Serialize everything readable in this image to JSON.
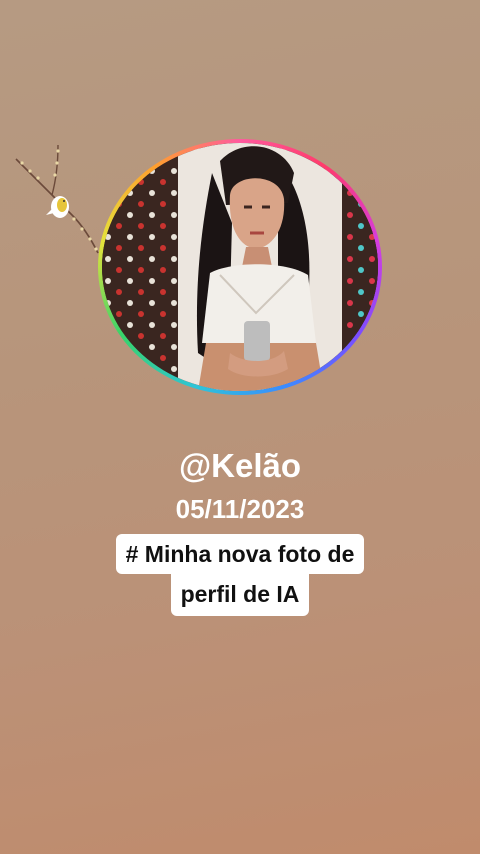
{
  "profile": {
    "username": "@Kelão",
    "date": "05/11/2023",
    "caption_line1": "# Minha nova foto de",
    "caption_line2": "perfil de IA"
  },
  "colors": {
    "background": "#b7957b",
    "text": "#ffffff",
    "caption_bg": "#ffffff",
    "caption_text": "#111111"
  },
  "icons": {
    "decoration": "bird-on-branch-icon"
  }
}
